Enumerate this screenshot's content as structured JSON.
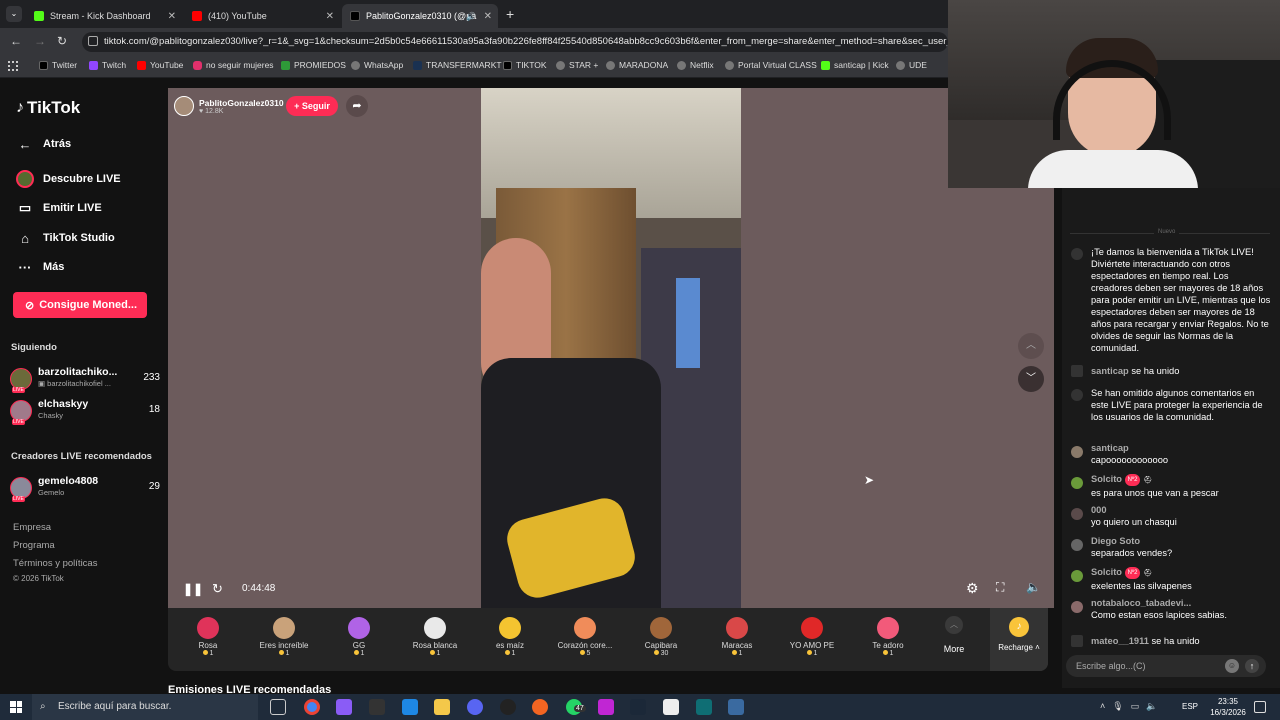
{
  "browser": {
    "tabs": [
      {
        "label": "Stream - Kick Dashboard",
        "color": "#53fc18"
      },
      {
        "label": "(410) YouTube",
        "color": "#ff0000"
      },
      {
        "label": "PablitoGonzalez0310 (@pa",
        "color": "#000000"
      }
    ],
    "url": "tiktok.com/@pablitogonzalez030/live?_r=1&_svg=1&checksum=2d5b0c54e66611530a95a3fa90b226fe8ff84f25540d850648abb8cc9c603b6f&enter_from_merge=share&enter_method=share&sec_user_id=I",
    "bookmarks": [
      {
        "label": "Twitter",
        "color": "#000000"
      },
      {
        "label": "Twitch",
        "color": "#9146ff"
      },
      {
        "label": "YouTube",
        "color": "#ff0000"
      },
      {
        "label": "no seguir mujeres",
        "color": "#e1306c"
      },
      {
        "label": "PROMIEDOS",
        "color": "#2e9a38"
      },
      {
        "label": "WhatsApp",
        "color": "#777777"
      },
      {
        "label": "TRANSFERMARKT",
        "color": "#1a3151"
      },
      {
        "label": "TIKTOK",
        "color": "#000000"
      },
      {
        "label": "STAR +",
        "color": "#777777"
      },
      {
        "label": "MARADONA",
        "color": "#777777"
      },
      {
        "label": "Netflix",
        "color": "#777777"
      },
      {
        "label": "Portal Virtual CLASS",
        "color": "#777777"
      },
      {
        "label": "santicap | Kick",
        "color": "#53fc18"
      },
      {
        "label": "UDE",
        "color": "#777777"
      }
    ]
  },
  "sidebar": {
    "logo": "TikTok",
    "back": "Atrás",
    "nav": [
      "Descubre LIVE",
      "Emitir LIVE",
      "TikTok Studio",
      "Más"
    ],
    "coins_button": "Consigue Moned...",
    "following_title": "Siguiendo",
    "following": [
      {
        "name": "barzolitachiko...",
        "sub": "barzolitachikofiel ...",
        "count": "233"
      },
      {
        "name": "elchaskyy",
        "sub": "Chasky",
        "count": "18"
      }
    ],
    "recommended_title": "Creadores LIVE recomendados",
    "recommended": [
      {
        "name": "gemelo4808",
        "sub": "Gemelo",
        "count": "29"
      }
    ],
    "footer": [
      "Empresa",
      "Programa",
      "Términos y políticas",
      "© 2026 TikTok"
    ]
  },
  "live": {
    "host": "PablitoGonzalez0310",
    "likes": "12.8K",
    "follow": "+ Seguir",
    "time": "0:44:48",
    "recommended_heading": "Emisiones LIVE recomendadas"
  },
  "gifts": [
    {
      "name": "Rosa",
      "price": "1",
      "color": "#e0335a"
    },
    {
      "name": "Eres increíble",
      "price": "1",
      "color": "#c9a27a"
    },
    {
      "name": "GG",
      "price": "1",
      "color": "#b063e6"
    },
    {
      "name": "Rosa blanca",
      "price": "1",
      "color": "#e9e9e9"
    },
    {
      "name": "es maíz",
      "price": "1",
      "color": "#f4c430"
    },
    {
      "name": "Corazón core...",
      "price": "5",
      "color": "#f08c5a"
    },
    {
      "name": "Capibara",
      "price": "30",
      "color": "#a0663a"
    },
    {
      "name": "Maracas",
      "price": "1",
      "color": "#d94848"
    },
    {
      "name": "YO AMO PE",
      "price": "1",
      "color": "#e02828"
    },
    {
      "name": "Te adoro",
      "price": "1",
      "color": "#f25a7a"
    }
  ],
  "gift_more": "More",
  "recharge": "Recharge",
  "chat": {
    "top_faded": "Nuevo",
    "messages": [
      {
        "user": "",
        "text": "¡Te damos la bienvenida a TikTok LIVE! Diviértete interactuando con otros espectadores en tiempo real. Los creadores deben ser mayores de 18 años para poder emitir un LIVE, mientras que los espectadores deben ser mayores de 18 años para recargar y enviar Regalos. No te olvides de seguir las Normas de la comunidad."
      },
      {
        "user": "santicap",
        "text": "se ha unido"
      },
      {
        "user": "",
        "text": "Se han omitido algunos comentarios en este LIVE para proteger la experiencia de los usuarios de la comunidad."
      },
      {
        "user": "santicap",
        "text": "capoooooooooooo"
      },
      {
        "user": "Solcito",
        "badge": "Nº2",
        "text": "es para unos que van a pescar"
      },
      {
        "user": "000",
        "text": "yo quiero un chasqui"
      },
      {
        "user": "Diego Soto",
        "text": "separados vendes?"
      },
      {
        "user": "Solcito",
        "badge": "Nº2",
        "text": "exelentes las silvapenes"
      },
      {
        "user": "notabaloco_tabadevi...",
        "text": "Como estan esos lapices sabias."
      },
      {
        "user": "mateo__1911",
        "text": "se ha unido"
      }
    ],
    "input_placeholder": "Escribe algo...(C)"
  },
  "taskbar": {
    "search_placeholder": "Escribe aquí para buscar.",
    "badge": "47",
    "lang": "ESP",
    "time": "23:35",
    "date": "16/3/2026"
  }
}
